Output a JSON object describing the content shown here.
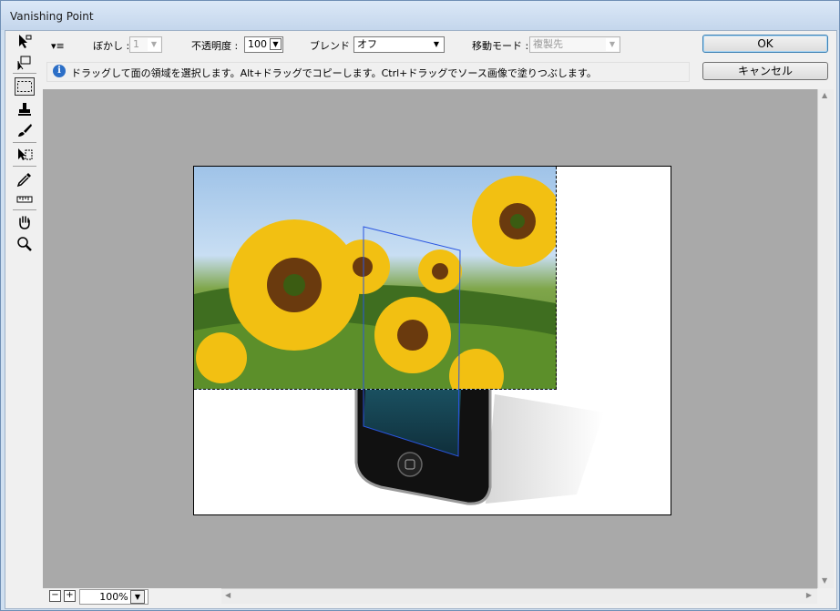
{
  "window": {
    "title": "Vanishing Point"
  },
  "options": {
    "menu_glyph": "▾≡",
    "feather_label": "ぼかし :",
    "feather_value": "1",
    "opacity_label": "不透明度 :",
    "opacity_value": "100",
    "blend_label": "ブレンド :",
    "blend_value": "オフ",
    "move_mode_label": "移動モード :",
    "move_mode_value": "複製先"
  },
  "buttons": {
    "ok": "OK",
    "cancel": "キャンセル"
  },
  "info": {
    "text": "ドラッグして面の領域を選択します。Alt+ドラッグでコピーします。Ctrl+ドラッグでソース画像で塗りつぶします。"
  },
  "tools": [
    {
      "icon": "edit-plane-tool-icon"
    },
    {
      "icon": "create-plane-tool-icon"
    },
    {
      "icon": "marquee-tool-icon"
    },
    {
      "icon": "stamp-tool-icon"
    },
    {
      "icon": "brush-tool-icon"
    },
    {
      "icon": "transform-tool-icon"
    },
    {
      "icon": "eyedropper-tool-icon"
    },
    {
      "icon": "measure-tool-icon"
    },
    {
      "icon": "hand-tool-icon"
    },
    {
      "icon": "zoom-tool-icon"
    }
  ],
  "status": {
    "zoom_value": "100%"
  },
  "colors": {
    "canvas_bg": "#a9a9a9",
    "plane_grid": "#2a55e0",
    "selection": "#000000"
  }
}
